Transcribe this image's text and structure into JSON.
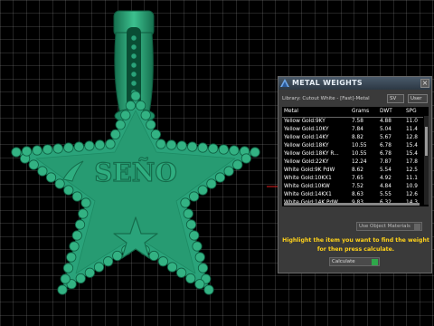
{
  "viewport": {
    "model_text": "SEÑO",
    "colors": {
      "grid": "#8c8c8c",
      "background": "#000000",
      "model": "#2aa37a",
      "model_dark": "#17704f",
      "red_marker": "#e02020"
    }
  },
  "panel": {
    "title": "METAL WEIGHTS",
    "close_symbol": "×",
    "library_label": "Library: Cutout White - [Fast]-Metal",
    "sv_label": "SV",
    "user_label": "User",
    "columns": [
      "Metal",
      "Grams",
      "DWT",
      "SPG"
    ],
    "rows": [
      {
        "metal": "Yellow Gold:9KY",
        "grams": "7.58",
        "dwt": "4.88",
        "spg": "11.0"
      },
      {
        "metal": "Yellow Gold:10KY",
        "grams": "7.84",
        "dwt": "5.04",
        "spg": "11.4"
      },
      {
        "metal": "Yellow Gold:14KY",
        "grams": "8.82",
        "dwt": "5.67",
        "spg": "12.8"
      },
      {
        "metal": "Yellow Gold:18KY",
        "grams": "10.55",
        "dwt": "6.78",
        "spg": "15.4"
      },
      {
        "metal": "Yellow Gold:18KY R...",
        "grams": "10.55",
        "dwt": "6.78",
        "spg": "15.4"
      },
      {
        "metal": "Yellow Gold:22KY",
        "grams": "12.24",
        "dwt": "7.87",
        "spg": "17.8"
      },
      {
        "metal": "White Gold:9K PdW",
        "grams": "8.62",
        "dwt": "5.54",
        "spg": "12.5"
      },
      {
        "metal": "White Gold:10KX1",
        "grams": "7.65",
        "dwt": "4.92",
        "spg": "11.1"
      },
      {
        "metal": "White Gold:10KW",
        "grams": "7.52",
        "dwt": "4.84",
        "spg": "10.9"
      },
      {
        "metal": "White Gold:14KX1",
        "grams": "8.63",
        "dwt": "5.55",
        "spg": "12.6"
      },
      {
        "metal": "White Gold:14K PdW",
        "grams": "9.83",
        "dwt": "6.32",
        "spg": "14.3"
      }
    ],
    "use_object_materials": "Use Object Materials",
    "instructions": "Highlight the item you want to find the weight for then press calculate.",
    "calculate_label": "Calculate",
    "colors": {
      "title_text": "#e6eef6",
      "instructions": "#ffd21a",
      "go": "#2fa84a"
    }
  }
}
